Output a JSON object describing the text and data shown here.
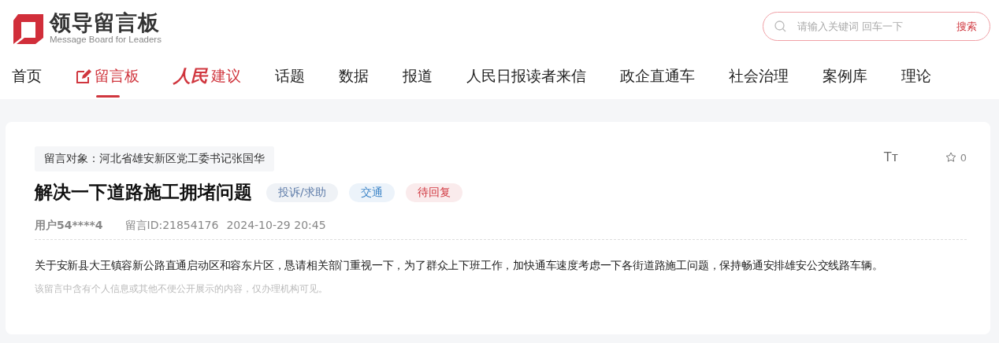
{
  "logo": {
    "title": "领导留言板",
    "subtitle": "Message Board for Leaders"
  },
  "search": {
    "placeholder": "请输入关键词 回车一下",
    "button": "搜索"
  },
  "nav": [
    {
      "label": "首页",
      "kind": "plain",
      "selected": false
    },
    {
      "label": "留言板",
      "kind": "pen",
      "selected": true
    },
    {
      "label": "人民",
      "suffix": "建议",
      "kind": "calligraphy",
      "selected": false
    },
    {
      "label": "话题",
      "kind": "plain",
      "selected": false
    },
    {
      "label": "数据",
      "kind": "plain",
      "selected": false
    },
    {
      "label": "报道",
      "kind": "plain",
      "selected": false
    },
    {
      "label": "人民日报读者来信",
      "kind": "plain",
      "selected": false
    },
    {
      "label": "政企直通车",
      "kind": "plain",
      "selected": false
    },
    {
      "label": "社会治理",
      "kind": "plain",
      "selected": false
    },
    {
      "label": "案例库",
      "kind": "plain",
      "selected": false
    },
    {
      "label": "理论",
      "kind": "plain",
      "selected": false
    }
  ],
  "message": {
    "target": "留言对象：河北省雄安新区党工委书记张国华",
    "font_button": "Tт",
    "favorites": "0",
    "title": "解决一下道路施工拥堵问题",
    "tags": [
      {
        "label": "投诉/求助",
        "color": "#5d7ba8"
      },
      {
        "label": "交通",
        "color": "#3f86c8"
      },
      {
        "label": "待回复",
        "color": "#d0363e"
      }
    ],
    "user": "用户54****4",
    "id": "留言ID:21854176",
    "time": "2024-10-29 20:45",
    "body": "关于安新县大王镇容新公路直通启动区和容东片区，恳请相关部门重视一下，为了群众上下班工作，加快通车速度考虑一下各街道路施工问题，保持畅通安排雄安公交线路车辆。",
    "note": "该留言中含有个人信息或其他不便公开展示的内容，仅办理机构可见。"
  }
}
